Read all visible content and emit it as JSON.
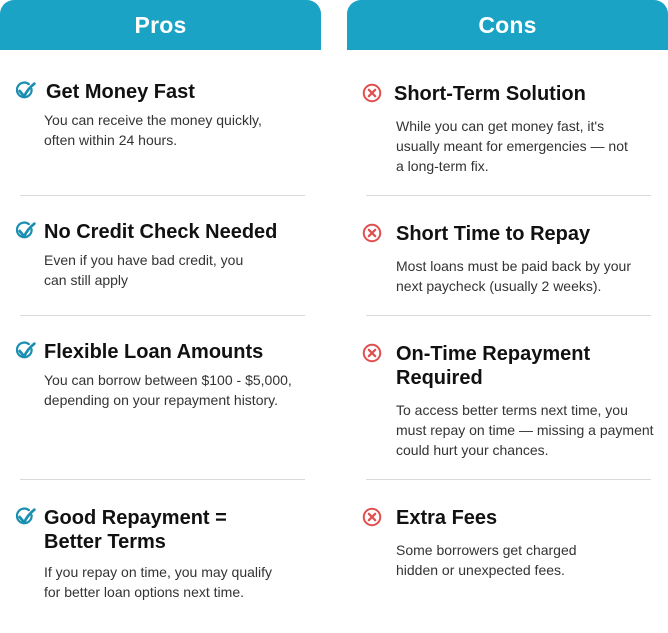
{
  "pros": {
    "header": "Pros",
    "items": [
      {
        "title": "Get Money Fast",
        "desc": "You can receive the money quickly, often within 24 hours."
      },
      {
        "title": "No Credit Check Needed",
        "desc": "Even if you have bad credit, you can still apply"
      },
      {
        "title": "Flexible Loan Amounts",
        "desc": "You can borrow between $100 - $5,000, depending on your repayment history."
      },
      {
        "title": "Good Repayment = Better Terms",
        "desc": "If you repay on time, you may qualify for better loan options next time."
      }
    ]
  },
  "cons": {
    "header": "Cons",
    "items": [
      {
        "title": "Short-Term Solution",
        "desc": "While you can get money fast, it's usually meant for emergencies — not a long-term fix."
      },
      {
        "title": "Short Time to Repay",
        "desc": "Most loans must be paid back by your next paycheck (usually 2 weeks)."
      },
      {
        "title": "On-Time Repayment Required",
        "desc": "To access better terms next time, you must repay on time — missing a payment could hurt your chances."
      },
      {
        "title": "Extra Fees",
        "desc": "Some borrowers get charged hidden or unexpected fees."
      }
    ]
  },
  "icons": {
    "pro": "check-icon",
    "con": "x-circle-icon"
  },
  "colors": {
    "header": "#1aa3c4",
    "check": "#1a8fb0",
    "x": "#e0504f"
  }
}
